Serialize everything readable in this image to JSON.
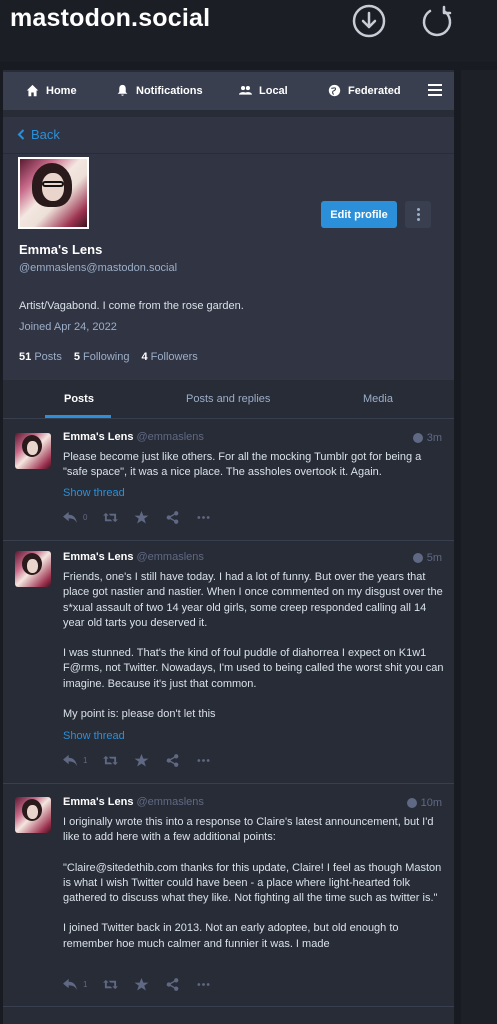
{
  "app": {
    "title": "mastodon.social"
  },
  "top_icons": [
    "download-circle-icon",
    "refresh-icon"
  ],
  "nav": {
    "items": [
      {
        "label": "Home",
        "icon": "home-icon"
      },
      {
        "label": "Notifications",
        "icon": "bell-icon"
      },
      {
        "label": "Local",
        "icon": "users-icon"
      },
      {
        "label": "Federated",
        "icon": "globe-icon"
      }
    ],
    "menu_icon": "hamburger-icon"
  },
  "back": {
    "label": "Back"
  },
  "profile": {
    "display_name": "Emma's Lens",
    "handle": "@emmaslens@mastodon.social",
    "bio": "Artist/Vagabond. I come from the rose garden.",
    "joined": "Joined Apr 24, 2022",
    "edit_label": "Edit profile",
    "stats": {
      "posts_count": "51",
      "posts_label": "Posts",
      "following_count": "5",
      "following_label": "Following",
      "followers_count": "4",
      "followers_label": "Followers"
    }
  },
  "tabs": [
    {
      "label": "Posts",
      "active": true
    },
    {
      "label": "Posts and replies",
      "active": false
    },
    {
      "label": "Media",
      "active": false
    }
  ],
  "statuses": [
    {
      "name": "Emma's Lens",
      "acct": "@emmaslens",
      "time": "3m",
      "paragraphs": [
        "Please become just like others. For all the mocking Tumblr got for being a \"safe space\", it was a nice place. The assholes overtook it. Again."
      ],
      "thread_label": "Show thread",
      "reply_count": "0"
    },
    {
      "name": "Emma's Lens",
      "acct": "@emmaslens",
      "time": "5m",
      "paragraphs": [
        "Friends, one's I still have today. I had a lot of funny. But over the years that place got nastier and nastier. When I once commented on my disgust over the s*xual assault of two 14 year old girls, some creep responded calling all 14 year old tarts you deserved it.",
        "I was stunned. That's the kind of foul puddle of diahorrea I expect on K1w1 F@rms, not Twitter. Nowadays, I'm used to being called the worst shit you can imagine. Because it's just that common.",
        "My point is: please don't let this"
      ],
      "thread_label": "Show thread",
      "reply_count": "1"
    },
    {
      "name": "Emma's Lens",
      "acct": "@emmaslens",
      "time": "10m",
      "paragraphs": [
        "I originally wrote this into a response to Claire's latest announcement, but I'd like to add here with a few additional points:",
        "\"Claire@sitedethib.com thanks for this update, Claire! I feel as though Maston is what I wish Twitter could have been - a place where light-hearted folk gathered to discuss what they like. Not fighting all the time such as twitter is.\"",
        "I joined Twitter back in 2013. Not an early adoptee, but old enough to remember hoe much calmer and funnier it was. I made"
      ],
      "thread_label": "",
      "reply_count": "1"
    }
  ],
  "colors": {
    "accent": "#2b90d9",
    "background": "#191b22",
    "panel": "#282c37",
    "nav": "#393f4f"
  }
}
